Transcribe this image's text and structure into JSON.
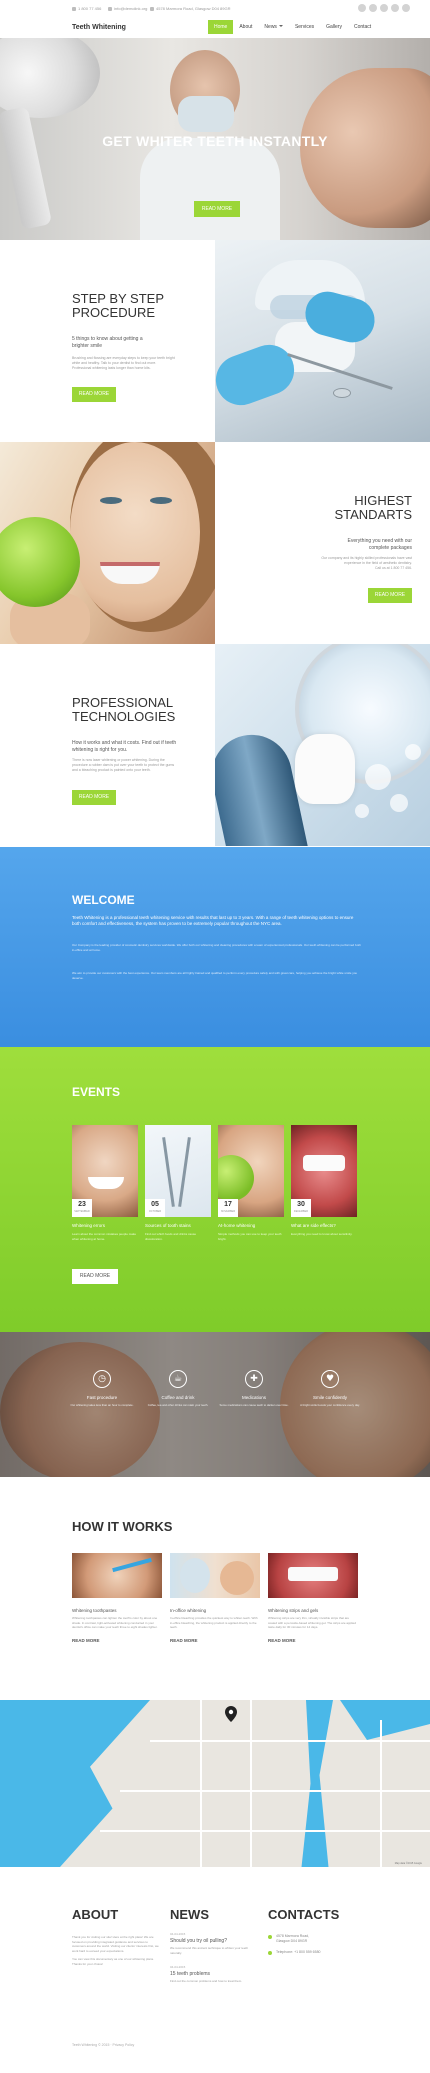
{
  "topbar": {
    "phone": "1 800 77 456",
    "email": "info@demolink.org",
    "address": "4578 Marmora Road, Glasgow D04 89GR"
  },
  "header": {
    "logo": "Teeth Whitening",
    "nav": [
      {
        "label": "Home"
      },
      {
        "label": "About"
      },
      {
        "label": "News"
      },
      {
        "label": "Services"
      },
      {
        "label": "Gallery"
      },
      {
        "label": "Contact"
      }
    ]
  },
  "hero": {
    "title": "GET WHITER TEETH INSTANTLY",
    "button": "READ MORE"
  },
  "features": [
    {
      "title_1": "STEP BY STEP",
      "title_2": "PROCEDURE",
      "subtitle_1": "5 things to know about getting a",
      "subtitle_2": "brighter smile",
      "body_1": "Brushing and flossing are everyday steps to keep your teeth bright",
      "body_2": "white and healthy. Talk to your dentist to find out more.",
      "body_3": "Professional whitening lasts longer than home kits.",
      "button": "READ MORE"
    },
    {
      "title_1": "HIGHEST",
      "title_2": "STANDARTS",
      "subtitle_1": "Everything you need with our",
      "subtitle_2": "complete packages",
      "body_1": "Our company and its highly skilled professionals have vast",
      "body_2": "experience in the field of aesthetic dentistry.",
      "body_3": "Call us at 1 800 77 456.",
      "button": "READ MORE"
    },
    {
      "title_1": "PROFESSIONAL",
      "title_2": "TECHNOLOGIES",
      "subtitle_1": "How it works and what it costs. Find out if teeth",
      "subtitle_2": "whitening is right for you.",
      "body_1": "There is now laser whitening or power whitening. During the",
      "body_2": "procedure a rubber dam is put over your teeth to protect the gums",
      "body_3": "and a bleaching product is painted onto your teeth.",
      "button": "READ MORE"
    }
  ],
  "welcome": {
    "title": "WELCOME",
    "lead": "Teeth Whitening is a professional teeth whitening service with results that last up to 3 years. With a range of teeth whitening options to ensure both comfort and effectiveness, the system has proven to be extremely popular throughout the NYC area.",
    "para_1": "Our Company is the leading provider of cosmetic dentistry services worldwide. We offer both our whitening and cleaning procedures with a team of experienced professionals. Our teeth whitening can be performed both in-office and at home.",
    "para_2": "We aim to provide our customers with the best experience. Our team members are all highly trained and qualified to perform every procedure safely and with great care, helping you achieve the bright white smile you deserve."
  },
  "events": {
    "title": "EVENTS",
    "items": [
      {
        "day": "23",
        "month": "SEPTEMBER",
        "name": "Whitening errors",
        "desc": "Learn about the common mistakes people make when whitening at home."
      },
      {
        "day": "05",
        "month": "OCTOBER",
        "name": "Sources of tooth stains",
        "desc": "Find out which foods and drinks cause discoloration."
      },
      {
        "day": "17",
        "month": "NOVEMBER",
        "name": "At-home whitening",
        "desc": "Simple methods you can use to keep your teeth bright."
      },
      {
        "day": "30",
        "month": "DECEMBER",
        "name": "What are side effects?",
        "desc": "Everything you need to know about sensitivity."
      }
    ],
    "button": "READ MORE"
  },
  "services": [
    {
      "icon": "clock-icon",
      "name": "Fast procedure",
      "desc": "Our whitening takes less than an hour to complete."
    },
    {
      "icon": "coffee-icon",
      "name": "Coffee and drink",
      "desc": "Coffee, tea and other drinks can stain your teeth."
    },
    {
      "icon": "medication-icon",
      "name": "Medications",
      "desc": "Some medications can cause teeth to darken over time."
    },
    {
      "icon": "heart-icon",
      "name": "Smile confidently",
      "desc": "A bright smile boosts your confidence every day."
    }
  ],
  "how": {
    "title": "HOW IT WORKS",
    "items": [
      {
        "name": "Whitening toothpastes",
        "desc": "Whitening toothpastes can lighten the tooth's color by about one shade. In contrast, light-activated whitening conducted in your dentist's office can make your teeth three to eight shades lighter.",
        "more": "READ MORE"
      },
      {
        "name": "In-office whitening",
        "desc": "In-office bleaching provides the quickest way to whiten teeth. With in-office bleaching, the whitening product is applied directly to the teeth.",
        "more": "READ MORE"
      },
      {
        "name": "Whitening strips and gels",
        "desc": "Whitening strips are very thin, virtually invisible strips that are coated with a peroxide-based whitening gel. The strips are applied twice daily for 30 minutes for 14 days.",
        "more": "READ MORE"
      }
    ]
  },
  "map": {
    "credit": "Map data ©2015 Google"
  },
  "footer": {
    "about": {
      "title": "ABOUT",
      "text_1": "Thank you for visiting our site! Here at the right place! We are focused on providing integrated",
      "text_2": "guidance and services to customers around the world. Visiting our clients' interests first, we work hard to exceed your expectations.",
      "text_3": "You can view this documentary as one of our whitening plans. Thanks for your choice!"
    },
    "news": {
      "title": "NEWS",
      "items": [
        {
          "date": "04-04-2015",
          "headline": "Should you try oil pulling?",
          "summary": "We recommend this ancient technique to whiten your teeth naturally."
        },
        {
          "date": "04-04-2015",
          "headline": "15 teeth problems",
          "summary": "Find out the common problems and how to treat them."
        }
      ]
    },
    "contacts": {
      "title": "CONTACTS",
      "address_1": "4578 Marmora Road,",
      "address_2": "Glasgow D04 89GR",
      "phone": "Telephone: +1 800 559 6580"
    },
    "copyright": "Teeth Whitening © 2015 · Privacy Policy"
  }
}
